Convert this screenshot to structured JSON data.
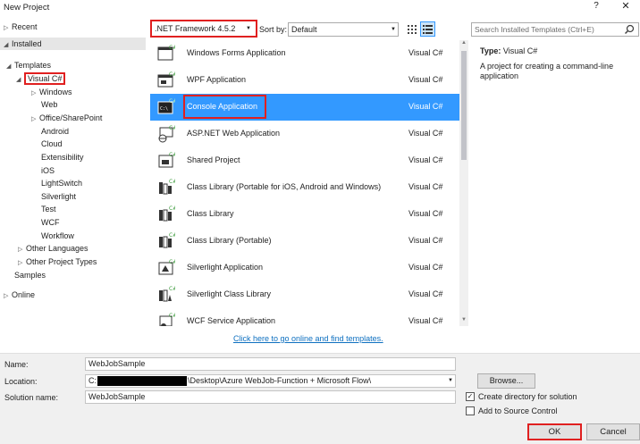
{
  "window": {
    "title": "New Project",
    "help": "?",
    "close": "✕"
  },
  "tree": {
    "recent": "Recent",
    "installed": "Installed",
    "templates": "Templates",
    "visual_csharp": "Visual C#",
    "children": [
      "Windows",
      "Web",
      "Office/SharePoint",
      "Android",
      "Cloud",
      "Extensibility",
      "iOS",
      "LightSwitch",
      "Silverlight",
      "Test",
      "WCF",
      "Workflow"
    ],
    "other_languages": "Other Languages",
    "other_project_types": "Other Project Types",
    "samples": "Samples",
    "online": "Online"
  },
  "toolbar": {
    "framework": ".NET Framework 4.5.2",
    "sort_label": "Sort by:",
    "sort_value": "Default",
    "search_placeholder": "Search Installed Templates (Ctrl+E)"
  },
  "templates": [
    {
      "name": "Windows Forms Application",
      "lang": "Visual C#"
    },
    {
      "name": "WPF Application",
      "lang": "Visual C#"
    },
    {
      "name": "Console Application",
      "lang": "Visual C#",
      "selected": true
    },
    {
      "name": "ASP.NET Web Application",
      "lang": "Visual C#"
    },
    {
      "name": "Shared Project",
      "lang": "Visual C#"
    },
    {
      "name": "Class Library (Portable for iOS, Android and Windows)",
      "lang": "Visual C#"
    },
    {
      "name": "Class Library",
      "lang": "Visual C#"
    },
    {
      "name": "Class Library (Portable)",
      "lang": "Visual C#"
    },
    {
      "name": "Silverlight Application",
      "lang": "Visual C#"
    },
    {
      "name": "Silverlight Class Library",
      "lang": "Visual C#"
    },
    {
      "name": "WCF Service Application",
      "lang": "Visual C#"
    }
  ],
  "online_link": "Click here to go online and find templates.",
  "details": {
    "type_label": "Type:",
    "type_value": "Visual C#",
    "description": "A project for creating a command-line application"
  },
  "form": {
    "name_label": "Name:",
    "name_value": "WebJobSample",
    "location_label": "Location:",
    "location_prefix": "C:",
    "location_suffix": "\\Desktop\\Azure WebJob-Function + Microsoft Flow\\",
    "solution_label": "Solution name:",
    "solution_value": "WebJobSample",
    "browse": "Browse...",
    "create_dir": "Create directory for solution",
    "create_dir_checked": true,
    "source_control": "Add to Source Control",
    "source_control_checked": false,
    "ok": "OK",
    "cancel": "Cancel"
  },
  "colors": {
    "selection": "#3399ff",
    "highlight_box": "#e02020",
    "link": "#0e70c0",
    "icon_green": "#3a9a3a"
  }
}
